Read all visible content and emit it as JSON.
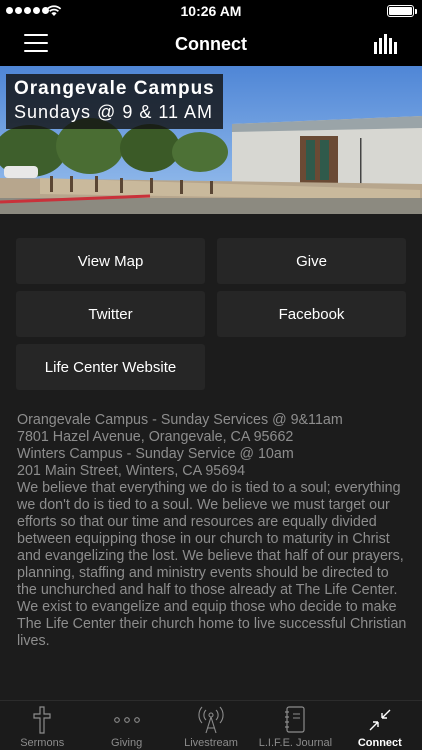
{
  "status_bar": {
    "time": "10:26 AM"
  },
  "nav": {
    "title": "Connect"
  },
  "banner": {
    "title": "Orangevale Campus",
    "subtitle": "Sundays @ 9 & 11 AM"
  },
  "buttons": {
    "view_map": "View Map",
    "give": "Give",
    "twitter": "Twitter",
    "facebook": "Facebook",
    "website": "Life Center Website"
  },
  "info": {
    "lines": [
      "Orangevale Campus - Sunday Services @ 9&11am",
      "7801 Hazel Avenue, Orangevale, CA 95662",
      "Winters Campus - Sunday Service @ 10am",
      "201 Main Street, Winters, CA 95694"
    ],
    "body": "We believe that everything we do is tied to a soul; everything we don't do is tied to a soul.  We believe we must target our efforts so that our time and resources are equally divided between equipping those in our church to maturity in Christ and evangelizing the lost.  We believe that half of our prayers, planning, staffing and ministry events should be directed to the unchurched and half to those already at The Life Center.  We exist to evangelize and equip those who decide to make The Life Center their church home to live successful Christian lives."
  },
  "tabs": [
    {
      "label": "Sermons",
      "icon": "cross-icon"
    },
    {
      "label": "Giving",
      "icon": "dots-icon"
    },
    {
      "label": "Livestream",
      "icon": "broadcast-icon"
    },
    {
      "label": "L.I.F.E. Journal",
      "icon": "journal-icon"
    },
    {
      "label": "Connect",
      "icon": "connect-icon",
      "active": true
    }
  ],
  "colors": {
    "background": "#1c1c1c",
    "button": "#262626",
    "text_muted": "#8d8d8d",
    "bar": "#000000"
  }
}
